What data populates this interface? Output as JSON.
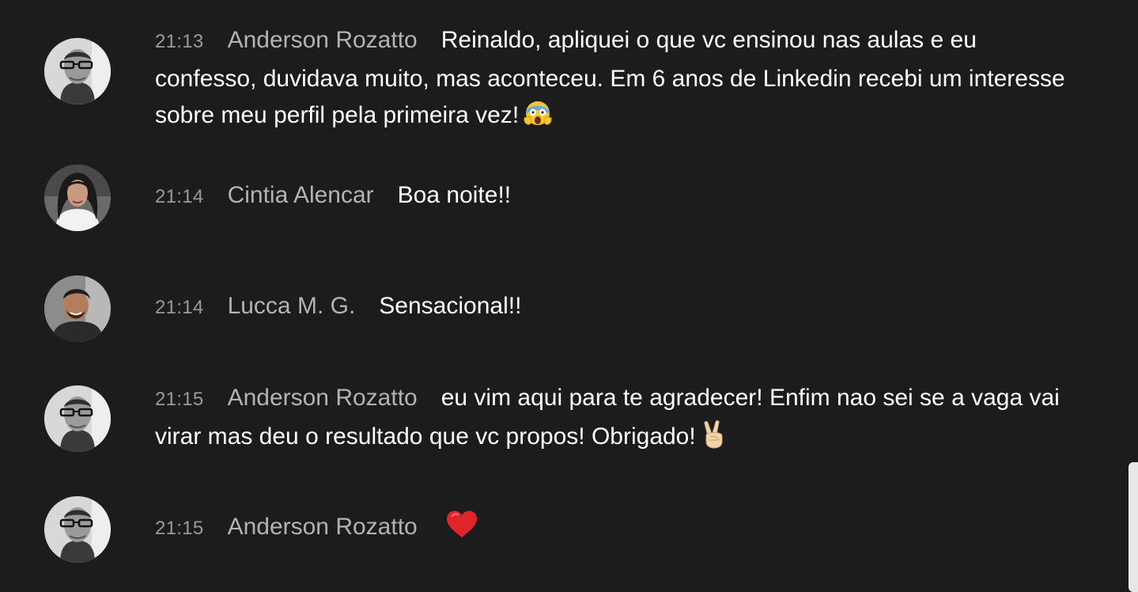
{
  "colors": {
    "background": "#1c1c1c",
    "timestamp": "#9a9a9a",
    "author": "#b3b3b3",
    "message": "#ffffff",
    "heart": "#e0242a"
  },
  "messages": [
    {
      "time": "21:13",
      "author": "Anderson Rozatto",
      "text": "Reinaldo, apliquei o que vc ensinou nas aulas e eu confesso, duvidava muito, mas aconteceu. Em 6 anos de Linkedin recebi um interesse sobre meu perfil pela primeira vez!",
      "emoji": "screaming-face-icon"
    },
    {
      "time": "21:14",
      "author": "Cintia Alencar",
      "text": "Boa noite!!"
    },
    {
      "time": "21:14",
      "author": "Lucca M. G.",
      "text": "Sensacional!!"
    },
    {
      "time": "21:15",
      "author": "Anderson Rozatto",
      "text": "eu vim aqui para te agradecer! Enfim nao sei se a vaga vai virar mas deu o resultado que vc propos! Obrigado!",
      "emoji": "victory-hand-icon"
    },
    {
      "time": "21:15",
      "author": "Anderson Rozatto",
      "text": "",
      "emoji": "red-heart-icon"
    }
  ]
}
